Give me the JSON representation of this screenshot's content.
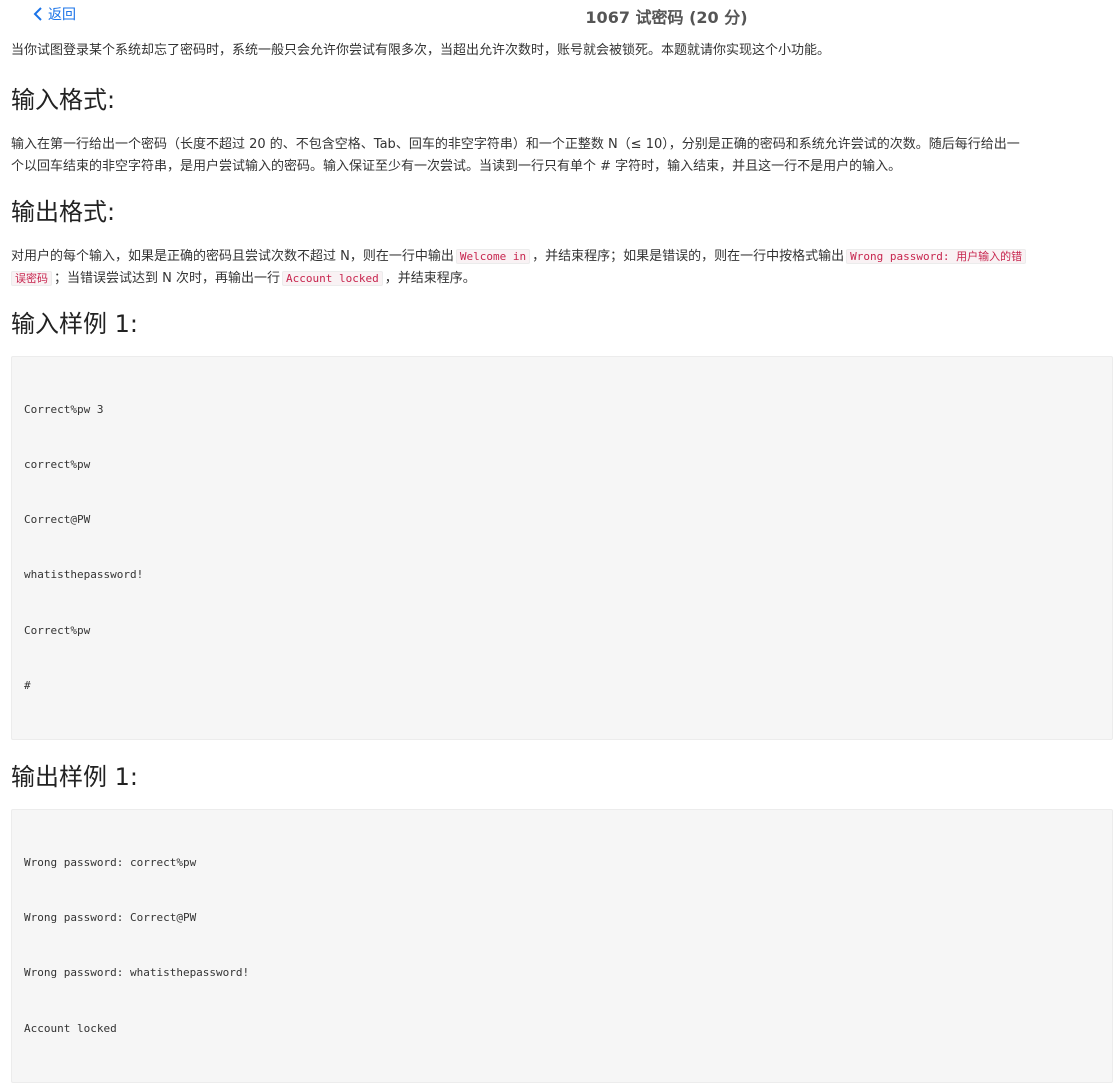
{
  "nav": {
    "back_label": "返回",
    "title": "1067 试密码 (20 分)"
  },
  "intro": "当你试图登录某个系统却忘了密码时，系统一般只会允许你尝试有限多次，当超出允许次数时，账号就会被锁死。本题就请你实现这个小功能。",
  "input_format": {
    "heading": "输入格式:",
    "line1": "输入在第一行给出一个密码（长度不超过 20 的、不包含空格、Tab、回车的非空字符串）和一个正整数 N（≤ 10），分别是正确的密码和系统允许尝试的次数。随后每行给出一",
    "line2": "个以回车结束的非空字符串，是用户尝试输入的密码。输入保证至少有一次尝试。当读到一行只有单个 # 字符时，输入结束，并且这一行不是用户的输入。"
  },
  "output_format": {
    "heading": "输出格式:",
    "text1": "对用户的每个输入，如果是正确的密码且尝试次数不超过 N，则在一行中输出",
    "code1": "Welcome in",
    "text2": "，并结束程序；如果是错误的，则在一行中按格式输出",
    "code2a": "Wrong password: 用户输入的错",
    "code2b": "误密码",
    "text3": "；当错误尝试达到 N 次时，再输出一行",
    "code3": "Account locked",
    "text4": "，并结束程序。"
  },
  "sample_input": {
    "heading": "输入样例 1:",
    "lines": [
      "Correct%pw 3",
      "correct%pw",
      "Correct@PW",
      "whatisthepassword!",
      "Correct%pw",
      "#"
    ]
  },
  "sample_output": {
    "heading": "输出样例 1:",
    "lines": [
      "Wrong password: correct%pw",
      "Wrong password: Correct@PW",
      "Wrong password: whatisthepassword!",
      "Account locked"
    ]
  },
  "colors": {
    "link": "#1a73e8",
    "inline_code": "#c7254e",
    "code_bg": "#f6f6f6"
  }
}
